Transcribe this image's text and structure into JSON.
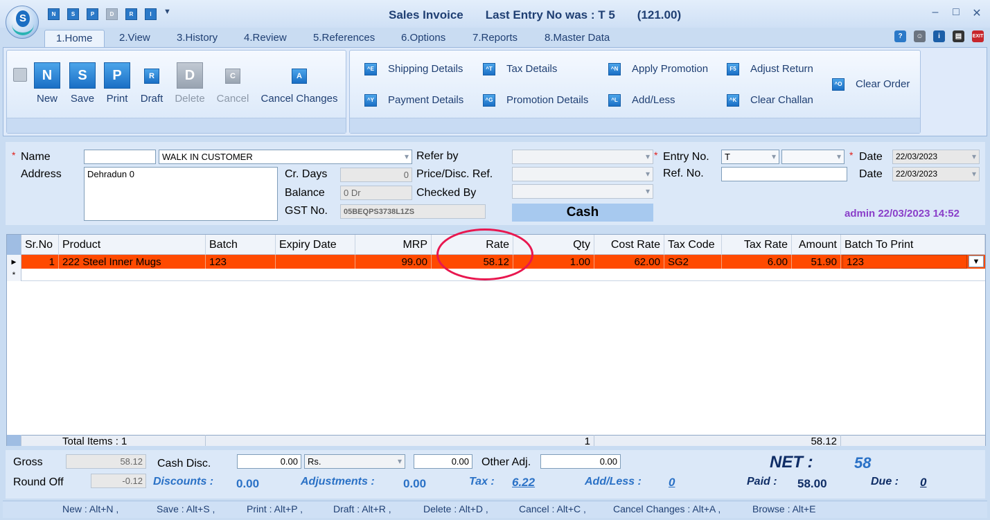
{
  "window": {
    "title": "Sales Invoice",
    "last_entry": "Last Entry No was : T 5",
    "last_amount": "(121.00)",
    "minimize": "–",
    "maximize": "□",
    "close": "✕"
  },
  "quick_access": [
    "N",
    "S",
    "P",
    "D",
    "R",
    "I"
  ],
  "tabs": [
    "1.Home",
    "2.View",
    "3.History",
    "4.Review",
    "5.References",
    "6.Options",
    "7.Reports",
    "8.Master Data"
  ],
  "ribbon": {
    "main_buttons": [
      {
        "label": "New",
        "glyph": "N",
        "enabled": true
      },
      {
        "label": "Save",
        "glyph": "S",
        "enabled": true
      },
      {
        "label": "Print",
        "glyph": "P",
        "enabled": true
      },
      {
        "label": "Draft",
        "glyph": "R",
        "enabled": true
      },
      {
        "label": "Delete",
        "glyph": "D",
        "enabled": false
      },
      {
        "label": "Cancel",
        "glyph": "C",
        "enabled": false
      },
      {
        "label": "Cancel Changes",
        "glyph": "A",
        "enabled": true
      }
    ],
    "detail_buttons": [
      {
        "label": "Shipping Details",
        "glyph": "^E"
      },
      {
        "label": "Payment Details",
        "glyph": "^Y"
      },
      {
        "label": "Tax Details",
        "glyph": "^T"
      },
      {
        "label": "Promotion Details",
        "glyph": "^G"
      },
      {
        "label": "Apply Promotion",
        "glyph": "^N"
      },
      {
        "label": "Add/Less",
        "glyph": "^L"
      },
      {
        "label": "Adjust Return",
        "glyph": "F5"
      },
      {
        "label": "Clear Challan",
        "glyph": "^K"
      },
      {
        "label": "Clear Order",
        "glyph": "^O"
      }
    ]
  },
  "form": {
    "name_label": "Name",
    "name_code": "",
    "customer": "WALK IN CUSTOMER",
    "address_label": "Address",
    "address": "Dehradun 0",
    "cr_days_label": "Cr. Days",
    "cr_days": "0",
    "balance_label": "Balance",
    "balance": "0 Dr",
    "gst_label": "GST No.",
    "gst": "05BEQPS3738L1ZS",
    "refer_by_label": "Refer by",
    "price_ref_label": "Price/Disc. Ref.",
    "checked_by_label": "Checked By",
    "payment_mode": "Cash",
    "entry_no_label": "Entry No.",
    "entry_series": "T",
    "ref_no_label": "Ref. No.",
    "date_label": "Date",
    "date1": "22/03/2023",
    "date2": "22/03/2023",
    "stamp": "admin 22/03/2023 14:52"
  },
  "grid": {
    "columns": [
      "Sr.No",
      "Product",
      "Batch",
      "Expiry Date",
      "MRP",
      "Rate",
      "Qty",
      "Cost Rate",
      "Tax Code",
      "Tax Rate",
      "Amount",
      "Batch To Print"
    ],
    "rows": [
      [
        "1",
        "222 Steel Inner Mugs",
        "123",
        "",
        "99.00",
        "58.12",
        "1.00",
        "62.00",
        "SG2",
        "6.00",
        "51.90",
        "123"
      ]
    ],
    "footer": {
      "total_items": "Total Items : 1",
      "qty": "1",
      "amount": "58.12"
    }
  },
  "totals": {
    "gross_label": "Gross",
    "gross": "58.12",
    "cash_disc_label": "Cash Disc.",
    "cash_disc": "0.00",
    "cash_disc_unit": "Rs.",
    "cash_disc_amt": "0.00",
    "other_adj_label": "Other Adj.",
    "other_adj": "0.00",
    "round_off_label": "Round Off",
    "round_off": "-0.12",
    "discounts_label": "Discounts :",
    "discounts": "0.00",
    "adjustments_label": "Adjustments :",
    "adjustments": "0.00",
    "tax_label": "Tax :",
    "tax": "6.22",
    "addless_label": "Add/Less :",
    "addless": "0",
    "net_label": "NET :",
    "net": "58",
    "paid_label": "Paid :",
    "paid": "58.00",
    "due_label": "Due :",
    "due": "0"
  },
  "shortcuts": [
    "New : Alt+N ,",
    "Save : Alt+S ,",
    "Print : Alt+P ,",
    "Draft : Alt+R ,",
    "Delete : Alt+D ,",
    "Cancel : Alt+C ,",
    "Cancel Changes : Alt+A ,",
    "Browse : Alt+E"
  ],
  "colors": {
    "selected_row": "#ff4a00",
    "accent": "#2a71c6",
    "stamp": "#8a3fc9",
    "annotation": "#e8174f"
  }
}
